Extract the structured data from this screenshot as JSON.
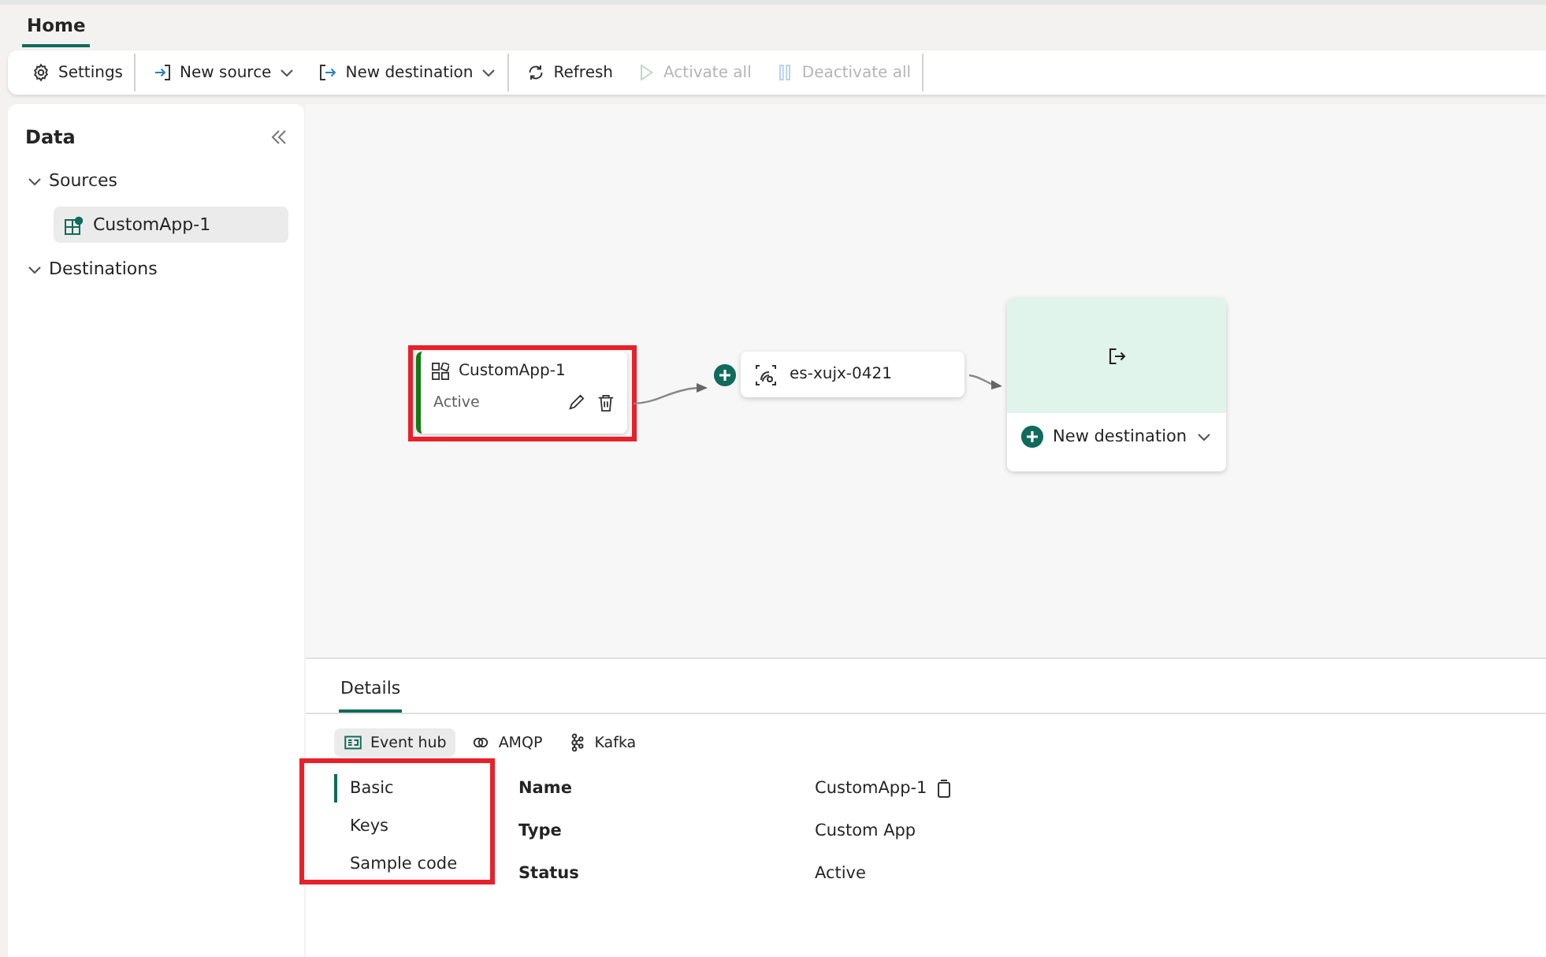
{
  "ribbon_tabs": [
    {
      "label": "Home",
      "selected": true
    }
  ],
  "toolbar": [
    {
      "label": "Settings",
      "kind": "gear",
      "dropdown": false,
      "disabled": false,
      "divider_after": true
    },
    {
      "label": "New source",
      "kind": "enter",
      "dropdown": true,
      "disabled": false,
      "divider_after": false
    },
    {
      "label": "New destination",
      "kind": "exit",
      "dropdown": true,
      "disabled": false,
      "divider_after": true
    },
    {
      "label": "Refresh",
      "kind": "refresh",
      "dropdown": false,
      "disabled": false,
      "divider_after": false
    },
    {
      "label": "Activate all",
      "kind": "play",
      "dropdown": false,
      "disabled": true,
      "divider_after": false
    },
    {
      "label": "Deactivate all",
      "kind": "pause",
      "dropdown": false,
      "disabled": true,
      "divider_after": true
    }
  ],
  "sidebar": {
    "title": "Data",
    "groups": [
      {
        "label": "Sources",
        "expanded": true,
        "items": [
          {
            "label": "CustomApp-1",
            "selected": true
          }
        ]
      },
      {
        "label": "Destinations",
        "expanded": true
      }
    ]
  },
  "canvas": {
    "source": {
      "name": "CustomApp-1",
      "status": "Active",
      "highlighted": true
    },
    "stream": {
      "name": "es-xujx-0421"
    },
    "destination": {
      "label": "New destination"
    }
  },
  "details": {
    "tabs": [
      {
        "label": "Details",
        "selected": true
      }
    ],
    "protocols": [
      {
        "label": "Event hub",
        "kind": "hub",
        "selected": true
      },
      {
        "label": "AMQP",
        "kind": "rings",
        "selected": false
      },
      {
        "label": "Kafka",
        "kind": "nodes",
        "selected": false
      }
    ],
    "nav": [
      {
        "label": "Basic",
        "selected": true
      },
      {
        "label": "Keys",
        "selected": false
      },
      {
        "label": "Sample code",
        "selected": false
      }
    ],
    "nav_highlighted": true,
    "properties": [
      {
        "label": "Name",
        "value": "CustomApp-1",
        "copyable": true
      },
      {
        "label": "Type",
        "value": "Custom App",
        "copyable": false
      },
      {
        "label": "Status",
        "value": "Active",
        "copyable": false
      }
    ]
  }
}
